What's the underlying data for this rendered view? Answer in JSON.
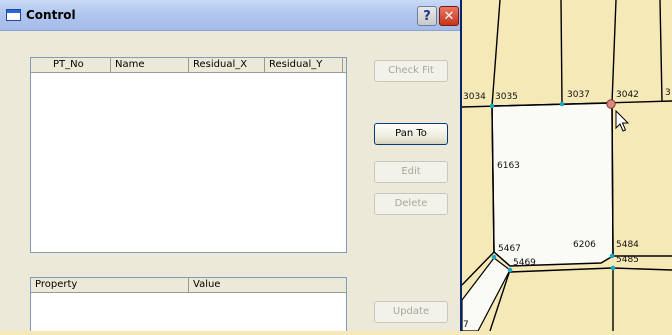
{
  "window": {
    "title": "Control",
    "help_glyph": "?",
    "close_glyph": "✕"
  },
  "residual_grid": {
    "columns": [
      "PT_No",
      "Name",
      "Residual_X",
      "Residual_Y"
    ]
  },
  "property_grid": {
    "columns": [
      "Property",
      "Value"
    ]
  },
  "buttons": {
    "check_fit": "Check Fit",
    "pan_to": "Pan To",
    "edit": "Edit",
    "delete": "Delete",
    "update": "Update"
  },
  "map": {
    "labels": [
      "3034",
      "3035",
      "3037",
      "3042",
      "3",
      "6163",
      "5467",
      "5469",
      "6206",
      "5484",
      "5485",
      "7"
    ]
  },
  "colors": {
    "parcel_fill": "#f6e9b8",
    "selected_parcel_fill": "#ffffff",
    "vertex": "#1aa7c4",
    "selected_vertex": "#d88a80"
  }
}
